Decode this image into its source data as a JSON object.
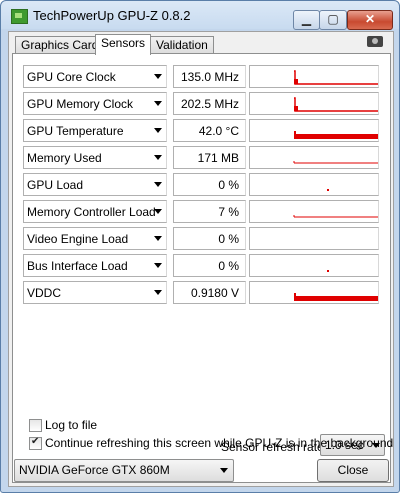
{
  "window": {
    "title": "TechPowerUp GPU-Z 0.8.2",
    "min_symbol": "▁",
    "max_symbol": "▢",
    "close_symbol": "✕"
  },
  "tabs": [
    {
      "label": "Graphics Card",
      "active": false
    },
    {
      "label": "Sensors",
      "active": true
    },
    {
      "label": "Validation",
      "active": false
    }
  ],
  "sensors": [
    {
      "label": "GPU Core Clock",
      "value": "135.0 MHz",
      "graph": "spike"
    },
    {
      "label": "GPU Memory Clock",
      "value": "202.5 MHz",
      "graph": "spike"
    },
    {
      "label": "GPU Temperature",
      "value": "42.0 °C",
      "graph": "thick"
    },
    {
      "label": "Memory Used",
      "value": "171 MB",
      "graph": "line"
    },
    {
      "label": "GPU Load",
      "value": "0 %",
      "graph": "dot"
    },
    {
      "label": "Memory Controller Load",
      "value": "7 %",
      "graph": "line"
    },
    {
      "label": "Video Engine Load",
      "value": "0 %",
      "graph": "none"
    },
    {
      "label": "Bus Interface Load",
      "value": "0 %",
      "graph": "dot"
    },
    {
      "label": "VDDC",
      "value": "0.9180 V",
      "graph": "thick"
    }
  ],
  "options": {
    "log_to_file": {
      "label": "Log to file",
      "checked": false
    },
    "continue_refreshing": {
      "label": "Continue refreshing this screen while GPU-Z is in the background",
      "checked": true
    },
    "refresh_rate_label": "Sensor refresh rate:",
    "refresh_rate_value": "1.0 sec"
  },
  "footer": {
    "gpu_name": "NVIDIA GeForce GTX 860M",
    "close_label": "Close"
  },
  "colors": {
    "graph": "#e00000"
  }
}
